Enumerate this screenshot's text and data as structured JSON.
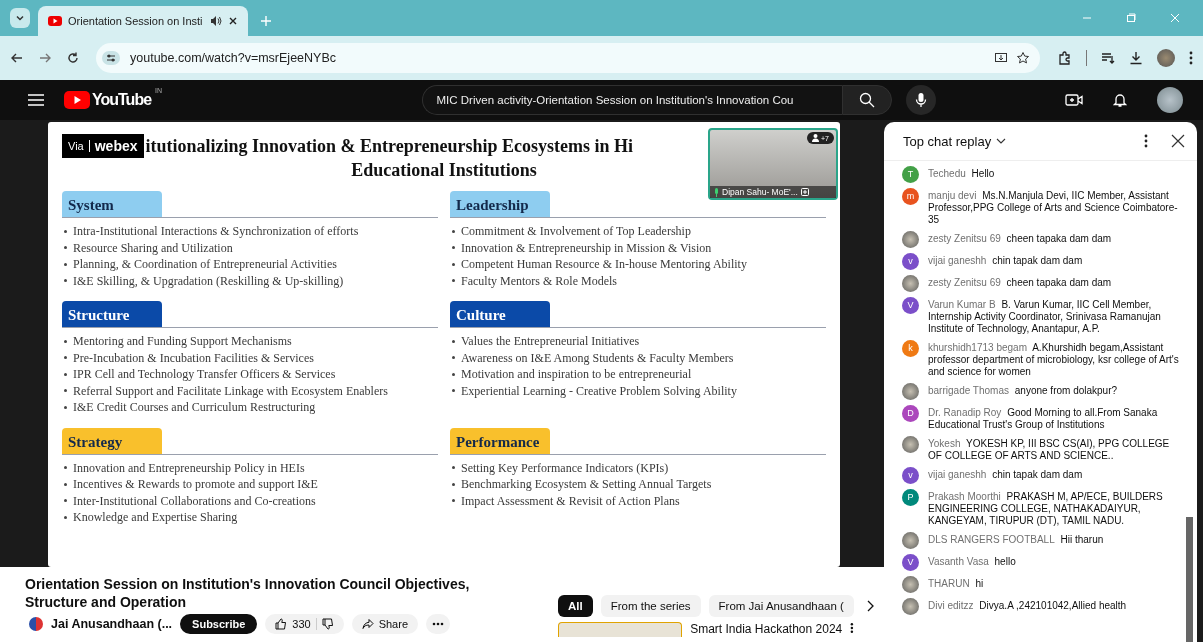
{
  "browser": {
    "tab": {
      "title": "Orientation Session on Insti"
    },
    "address": "youtube.com/watch?v=msrEjeeNYBc"
  },
  "youtube": {
    "logo": "YouTube",
    "region": "IN",
    "search": "MIC Driven activity-Orientation Session on Institution's Innovation Cou"
  },
  "slide": {
    "badge_via": "Via",
    "badge_brand": "webex",
    "title_lines": [
      "itutionalizing Innovation & Entrepreneurship Ecosystems in Hi",
      "Educational Institutions"
    ],
    "sections": [
      {
        "title": "System",
        "color": "#8ecdf0",
        "items": [
          "Intra-Institutional Interactions & Synchronization of  efforts",
          "Resource Sharing and Utilization",
          "Planning, & Coordination of  Entrepreneurial Activities",
          "I&E Skilling, & Upgradation (Reskilling & Up-skilling)"
        ]
      },
      {
        "title": "Leadership",
        "color": "#8ecdf0",
        "items": [
          "Commitment & Involvement of  Top Leadership",
          "Innovation & Entrepreneurship in Mission & Vision",
          "Competent Human Resource & In-house Mentoring Ability",
          "Faculty Mentors & Role Models"
        ]
      },
      {
        "title": "Structure",
        "color": "#0b4aa8",
        "items": [
          "Mentoring and Funding Support Mechanisms",
          "Pre-Incubation & Incubation Facilities & Services",
          "IPR Cell and Technology Transfer Officers & Services",
          "Referral Support and Facilitate Linkage with  Ecosystem Enablers",
          "I&E Credit Courses and Curriculum Restructuring"
        ]
      },
      {
        "title": "Culture",
        "color": "#0b4aa8",
        "items": [
          "Values the Entrepreneurial Initiatives",
          "Awareness on I&E Among Students & Faculty Members",
          "Motivation and inspiration to be entrepreneurial",
          "Experiential Learning - Creative Problem Solving Ability"
        ]
      },
      {
        "title": "Strategy",
        "color": "#f9c02c",
        "items": [
          "Innovation and Entrepreneurship Policy in HEIs",
          "Incentives & Rewards to promote and support I&E",
          "Inter-Institutional Collaborations and Co-creations",
          "Knowledge and Expertise Sharing"
        ]
      },
      {
        "title": "Performance",
        "color": "#f9c02c",
        "items": [
          "Setting Key Performance Indicators (KPIs)",
          "Benchmarking Ecosystem & Setting Annual Targets",
          "Impact Assessment & Revisit of  Action Plans"
        ]
      }
    ],
    "video_tile": {
      "participants": "+7",
      "caption": "Dipan Sahu- MoE'..."
    }
  },
  "video": {
    "title": "Orientation Session on Institution's Innovation Council Objectives, Structure and Operation",
    "channel": "Jai Anusandhaan (...",
    "subscribe": "Subscribe",
    "likes": "330",
    "share": "Share"
  },
  "chips": [
    {
      "label": "All",
      "selected": true
    },
    {
      "label": "From the series",
      "selected": false
    },
    {
      "label": "From Jai Anusandhaan (",
      "selected": false
    }
  ],
  "recommendation": {
    "title": "Smart India Hackathon 2024"
  },
  "chat": {
    "title": "Top chat replay",
    "messages": [
      {
        "author": "Techedu",
        "text": "Hello",
        "avatar": {
          "kind": "letter",
          "letter": "T",
          "color": "#43a047"
        }
      },
      {
        "author": "manju devi",
        "text": "Ms.N.Manjula Devi, IIC Member, Assistant Professor,PPG College of Arts and Science Coimbatore-35",
        "avatar": {
          "kind": "letter",
          "letter": "m",
          "color": "#e8531f"
        }
      },
      {
        "author": "zesty Zenitsu 69",
        "text": "cheen tapaka dam dam",
        "avatar": {
          "kind": "picture"
        }
      },
      {
        "author": "vijai ganeshh",
        "text": "chin tapak dam dam",
        "avatar": {
          "kind": "letter",
          "letter": "v",
          "color": "#7b4fc9"
        }
      },
      {
        "author": "zesty Zenitsu 69",
        "text": "cheen tapaka dam dam",
        "avatar": {
          "kind": "picture"
        }
      },
      {
        "author": "Varun Kumar B",
        "text": "B. Varun Kumar, IIC Cell Member, Internship Activity Coordinator, Srinivasa Ramanujan Institute of Technology, Anantapur, A.P.",
        "avatar": {
          "kind": "letter",
          "letter": "V",
          "color": "#7b4fc9"
        }
      },
      {
        "author": "khurshidh1713 begam",
        "text": "A.Khurshidh begam,Assistant professor department of microbiology, ksr college of Art's and science for women",
        "avatar": {
          "kind": "letter",
          "letter": "k",
          "color": "#ef7a14"
        }
      },
      {
        "author": "barrigade Thomas",
        "text": "anyone from dolakpur?",
        "avatar": {
          "kind": "picture"
        }
      },
      {
        "author": "Dr. Ranadip Roy",
        "text": "Good Morning to all.From Sanaka Educational Trust's Group of Institutions",
        "avatar": {
          "kind": "letter",
          "letter": "D",
          "color": "#ab47bc"
        }
      },
      {
        "author": "Yokesh",
        "text": "YOKESH KP, III BSC CS(AI), PPG COLLEGE OF COLLEGE OF ARTS AND SCIENCE..",
        "avatar": {
          "kind": "picture"
        }
      },
      {
        "author": "vijai ganeshh",
        "text": "chin tapak dam dam",
        "avatar": {
          "kind": "letter",
          "letter": "v",
          "color": "#7b4fc9"
        }
      },
      {
        "author": "Prakash Moorthi",
        "text": "PRAKASH M, AP/ECE, BUILDERS ENGINEERING COLLEGE, NATHAKADAIYUR, KANGEYAM, TIRUPUR (DT), TAMIL NADU.",
        "avatar": {
          "kind": "letter",
          "letter": "P",
          "color": "#00897b"
        }
      },
      {
        "author": "DLS RANGERS FOOTBALL",
        "text": "Hii tharun",
        "avatar": {
          "kind": "picture"
        }
      },
      {
        "author": "Vasanth Vasa",
        "text": "hello",
        "avatar": {
          "kind": "letter",
          "letter": "V",
          "color": "#7b4fc9"
        }
      },
      {
        "author": "THARUN",
        "text": "hi",
        "avatar": {
          "kind": "picture"
        }
      },
      {
        "author": "Divi editzz",
        "text": "Divya.A ,242101042,Allied health",
        "avatar": {
          "kind": "picture"
        }
      }
    ]
  }
}
